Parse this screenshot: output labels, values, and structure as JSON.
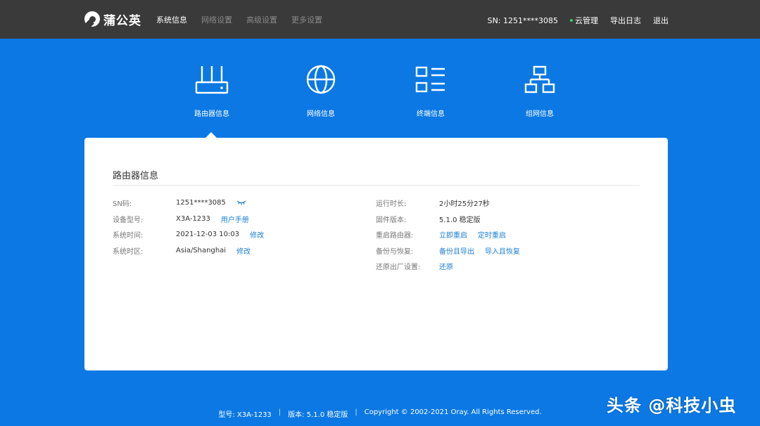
{
  "brand": {
    "name": "蒲公英"
  },
  "nav": {
    "items": [
      {
        "label": "系统信息",
        "active": true
      },
      {
        "label": "网络设置",
        "active": false
      },
      {
        "label": "高级设置",
        "active": false
      },
      {
        "label": "更多设置",
        "active": false
      }
    ]
  },
  "topright": {
    "sn": "SN:  1251****3085",
    "cloud": "云管理",
    "export_log": "导出日志",
    "logout": "退出"
  },
  "categories": [
    {
      "label": "路由器信息",
      "icon": "router-icon"
    },
    {
      "label": "网络信息",
      "icon": "globe-icon"
    },
    {
      "label": "终端信息",
      "icon": "list-icon"
    },
    {
      "label": "组网信息",
      "icon": "network-icon"
    }
  ],
  "card": {
    "title": "路由器信息",
    "left": [
      {
        "label": "SN码:",
        "value": "1251****3085"
      },
      {
        "label": "设备型号:",
        "value": "X3A-1233",
        "link": "用户手册"
      },
      {
        "label": "系统时间:",
        "value": "2021-12-03 10:03",
        "link": "修改"
      },
      {
        "label": "系统时区:",
        "value": "Asia/Shanghai",
        "link": "修改"
      }
    ],
    "right": [
      {
        "label": "运行时长:",
        "value": "2小时25分27秒"
      },
      {
        "label": "固件版本:",
        "value": "5.1.0 稳定版"
      },
      {
        "label": "重启路由器:",
        "link1": "立即重启",
        "link2": "定时重启"
      },
      {
        "label": "备份与恢复:",
        "link1": "备份且导出",
        "link2": "导入且恢复"
      },
      {
        "label": "还原出厂设置:",
        "link1": "还原"
      }
    ]
  },
  "footer": {
    "model": "型号:  X3A-1233",
    "sep": "|",
    "version": "版本:  5.1.0 稳定版",
    "copyright": "Copyright © 2002-2021 Oray. All Rights Reserved."
  },
  "watermark": "头条 @科技小虫",
  "colors": {
    "topbar": "#3a3a3a",
    "background": "#0b78e3",
    "link": "#1a7fd6",
    "cloud_dot": "#36d16b"
  }
}
